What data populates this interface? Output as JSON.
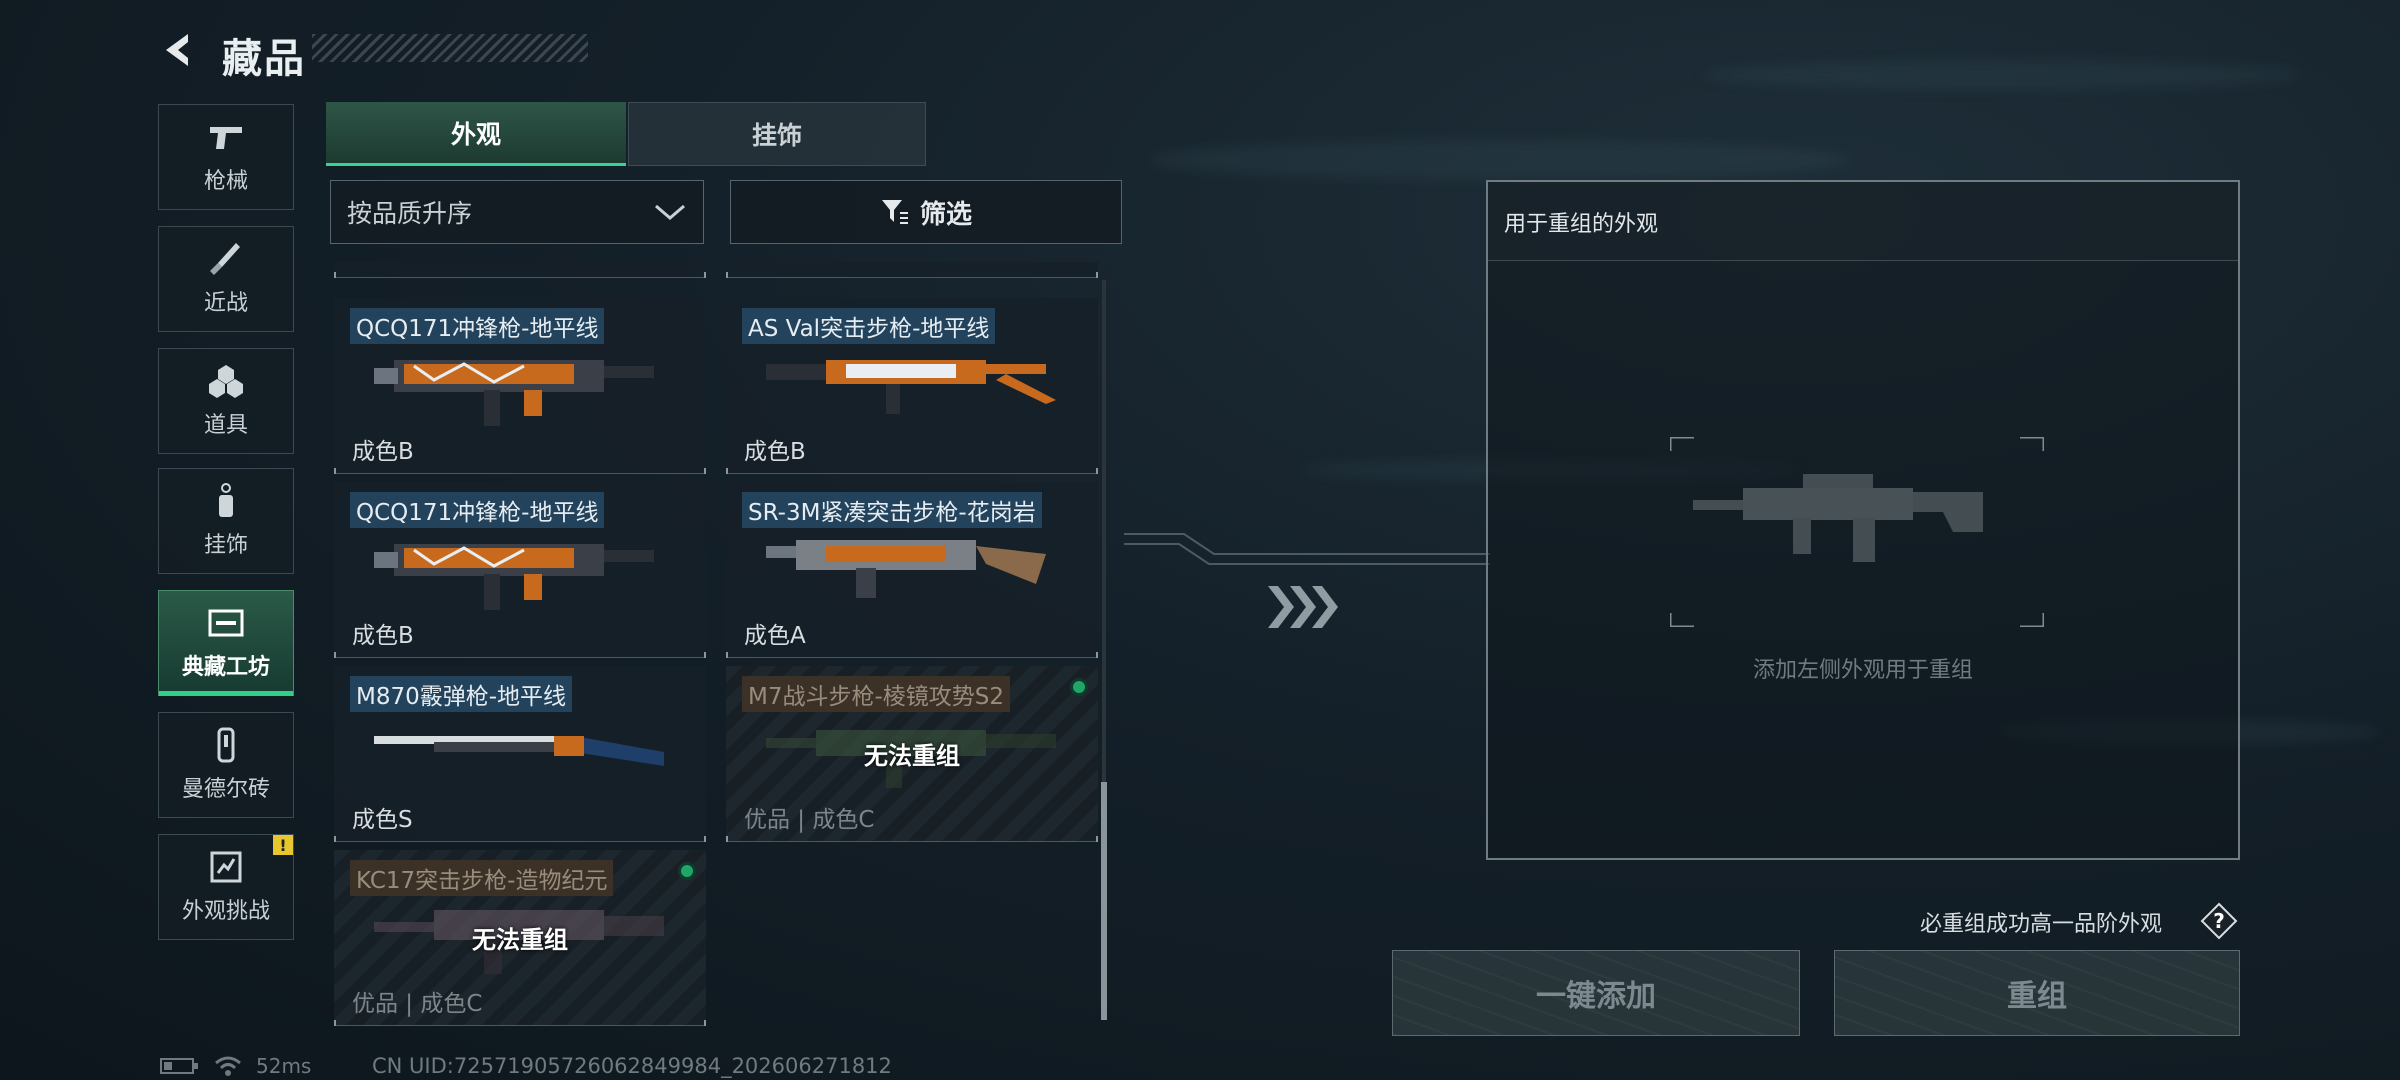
{
  "header": {
    "title": "藏品"
  },
  "nav": [
    {
      "label": "枪械",
      "icon": "pistol-icon"
    },
    {
      "label": "近战",
      "icon": "knife-icon"
    },
    {
      "label": "道具",
      "icon": "grenade-cluster-icon"
    },
    {
      "label": "挂饰",
      "icon": "charm-icon"
    },
    {
      "label": "典藏工坊",
      "icon": "workshop-icon",
      "active": true
    },
    {
      "label": "曼德尔砖",
      "icon": "brick-icon"
    },
    {
      "label": "外观挑战",
      "icon": "challenge-icon",
      "badge": "!"
    }
  ],
  "tabs": [
    {
      "label": "外观",
      "active": true
    },
    {
      "label": "挂饰",
      "active": false
    }
  ],
  "sort": {
    "label": "按品质升序"
  },
  "filter": {
    "label": "筛选"
  },
  "cards": [
    {
      "name": "QCQ171冲锋枪-地平线",
      "grade": "成色B",
      "disabled": false
    },
    {
      "name": "AS Val突击步枪-地平线",
      "grade": "成色B",
      "disabled": false
    },
    {
      "name": "QCQ171冲锋枪-地平线",
      "grade": "成色B",
      "disabled": false
    },
    {
      "name": "SR-3M紧凑突击步枪-花岗岩",
      "grade": "成色A",
      "disabled": false
    },
    {
      "name": "M870霰弹枪-地平线",
      "grade": "成色S",
      "disabled": false
    },
    {
      "name": "M7战斗步枪-棱镜攻势S2",
      "grade": "优品 | 成色C",
      "disabled": true,
      "overlay": "无法重组"
    },
    {
      "name": "KC17突击步枪-造物纪元",
      "grade": "优品 | 成色C",
      "disabled": true,
      "overlay": "无法重组"
    }
  ],
  "panel": {
    "title": "用于重组的外观",
    "placeholder": "添加左侧外观用于重组"
  },
  "hint": "必重组成功高一品阶外观",
  "help_label": "?",
  "buttons": {
    "add_all": "一键添加",
    "recombine": "重组"
  },
  "status": {
    "ping": "52ms",
    "uid": "CN UID:7257190572606284998​4_202606271812"
  },
  "colors": {
    "accent": "#2ed08a",
    "badge": "#e8c72e",
    "name_tag": "#23435c"
  }
}
